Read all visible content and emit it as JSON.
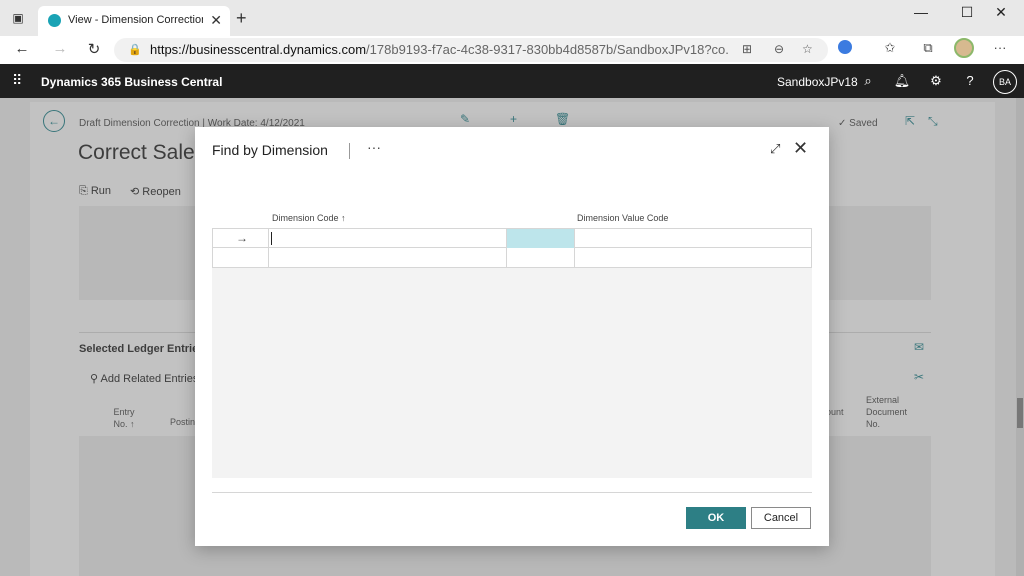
{
  "browser": {
    "tab_title": "View - Dimension Corrections - D",
    "new_tab": "+",
    "url_domain": "https://businesscentral.dynamics.com",
    "url_rest": "/178b9193-f7ac-4c38-9317-830bb4d8587b/SandboxJPv18?co..."
  },
  "bc_header": {
    "app_name": "Dynamics 365 Business Central",
    "environment": "SandboxJPv18",
    "avatar_initials": "BA"
  },
  "background_page": {
    "subtitle": "Draft Dimension Correction | Work Date: 4/12/2021",
    "title": "Correct Sales",
    "status": "Saved",
    "actions": {
      "run": "Run",
      "reopen": "Reopen"
    },
    "section_title": "Selected Ledger Entries",
    "add_related": "Add Related Entries",
    "columns": {
      "entry_no": "Entry No. ↑",
      "posting": "Postin",
      "amount": "ount",
      "external_doc": "External Document No."
    }
  },
  "dialog": {
    "title": "Find by Dimension",
    "more": "···",
    "columns": {
      "dimension_code": "Dimension Code ↑",
      "dimension_value_code": "Dimension Value Code"
    },
    "row_arrow": "→",
    "ok_label": "OK",
    "cancel_label": "Cancel"
  },
  "colors": {
    "bc_header_bg": "#202020",
    "primary_button": "#2d7f85",
    "active_cell": "#bde5eb",
    "accent": "#2e8b93"
  }
}
